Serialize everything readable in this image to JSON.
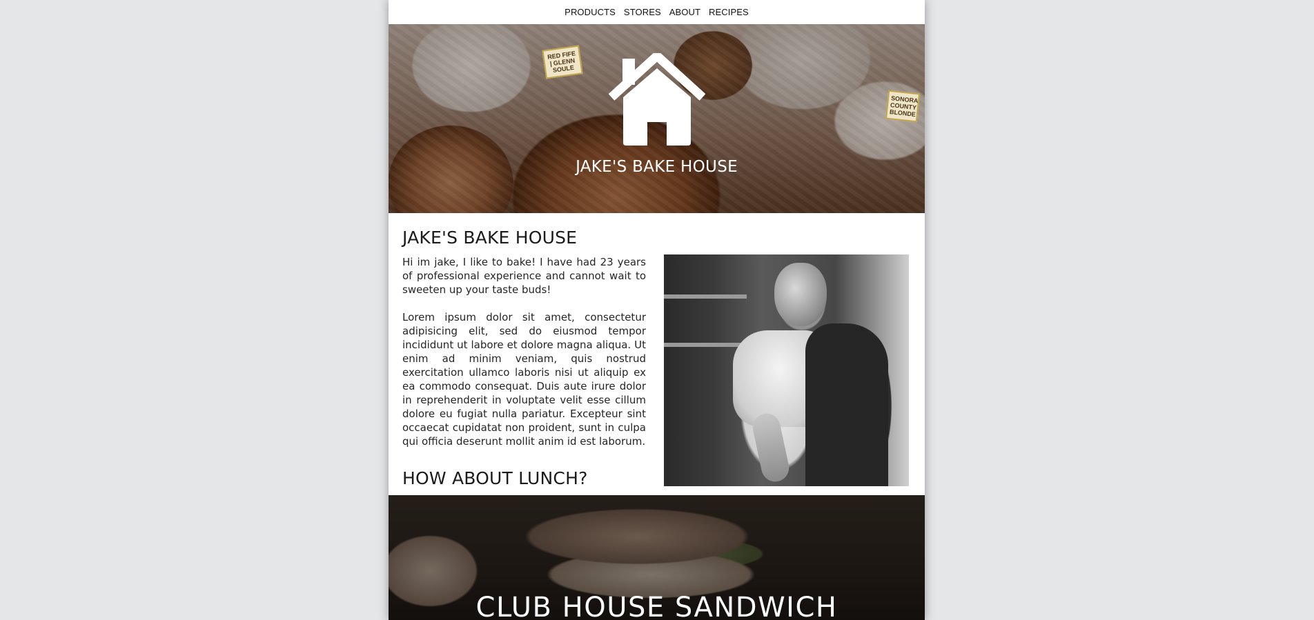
{
  "nav": {
    "items": [
      {
        "label": "PRODUCTS"
      },
      {
        "label": "STORES"
      },
      {
        "label": "ABOUT"
      },
      {
        "label": "RECIPES"
      }
    ]
  },
  "hero": {
    "icon": "home-icon",
    "title": "JAKE'S BAKE HOUSE",
    "tags": [
      {
        "text": "RED FIFE | GLENN SOULE"
      },
      {
        "text": "SONORA COUNTY BLONDE"
      }
    ]
  },
  "about": {
    "title": "JAKE'S BAKE HOUSE",
    "intro": "Hi im jake, I like to bake! I have had 23 years of professional experience and cannot wait to sweeten up your taste buds!",
    "body": "Lorem ipsum dolor sit amet, consectetur adipisicing elit, sed do eiusmod tempor incididunt ut labore et dolore magna aliqua. Ut enim ad minim veniam, quis nostrud exercitation ullamco laboris nisi ut aliquip ex ea commodo consequat. Duis aute irure dolor in reprehenderit in voluptate velit esse cillum dolore eu fugiat nulla pariatur. Excepteur sint occaecat cupidatat non proident, sunt in culpa qui officia deserunt mollit anim id est laborum.",
    "lunch_title": "HOW ABOUT LUNCH?"
  },
  "lunch": {
    "title": "CLUB HOUSE SANDWICH"
  },
  "colors": {
    "page_bg": "#e5e6e8",
    "content_bg": "#ffffff",
    "text": "#1d1d1d",
    "hero_text": "#ffffff"
  }
}
